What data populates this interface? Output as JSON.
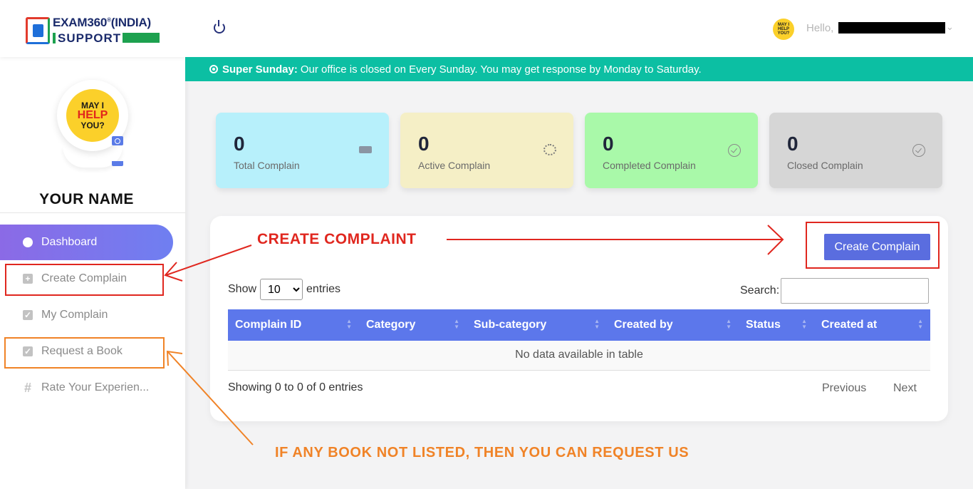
{
  "logo": {
    "line1": "EXAM360",
    "reg": "®",
    "line1_suffix": "(INDIA)",
    "line2": "SUPPORT"
  },
  "profile": {
    "avatar_text": [
      "MAY I",
      "HELP",
      "YOU?"
    ],
    "name": "YOUR NAME"
  },
  "sidebar": {
    "items": [
      {
        "label": "Dashboard",
        "icon": "pie-chart-icon"
      },
      {
        "label": "Create Complain",
        "icon": "plus-square-icon"
      },
      {
        "label": "My Complain",
        "icon": "check-square-icon"
      },
      {
        "label": "Request a Book",
        "icon": "check-square-icon"
      },
      {
        "label": "Rate Your Experien...",
        "icon": "hash-icon"
      }
    ]
  },
  "header": {
    "hello": "Hello,",
    "user_avatar_text": "MAY I HELP YOU?"
  },
  "notice": {
    "title": "Super Sunday:",
    "text": "Our office is closed on Every Sunday. You may get response by Monday to Saturday."
  },
  "stats": [
    {
      "value": "0",
      "label": "Total Complain",
      "color": "#b7f0fb",
      "icon": "ticket-icon"
    },
    {
      "value": "0",
      "label": "Active Complain",
      "color": "#f5efc6",
      "icon": "spinner-icon"
    },
    {
      "value": "0",
      "label": "Completed Complain",
      "color": "#a9f9a9",
      "icon": "check-circle-icon"
    },
    {
      "value": "0",
      "label": "Closed Complain",
      "color": "#d6d6d6",
      "icon": "check-circle-icon"
    }
  ],
  "panel": {
    "create_button": "Create Complain",
    "show": "Show",
    "entries_value": "10",
    "entries": "entries",
    "search_label": "Search:",
    "columns": [
      "Complain ID",
      "Category",
      "Sub-category",
      "Created by",
      "Status",
      "Created at"
    ],
    "empty": "No data available in table",
    "info": "Showing 0 to 0 of 0 entries",
    "previous": "Previous",
    "next": "Next"
  },
  "annotations": {
    "create": "CREATE COMPLAINT",
    "request": "IF ANY BOOK NOT LISTED, THEN YOU CAN REQUEST US",
    "red": "#e0271f",
    "orange": "#f08327"
  }
}
